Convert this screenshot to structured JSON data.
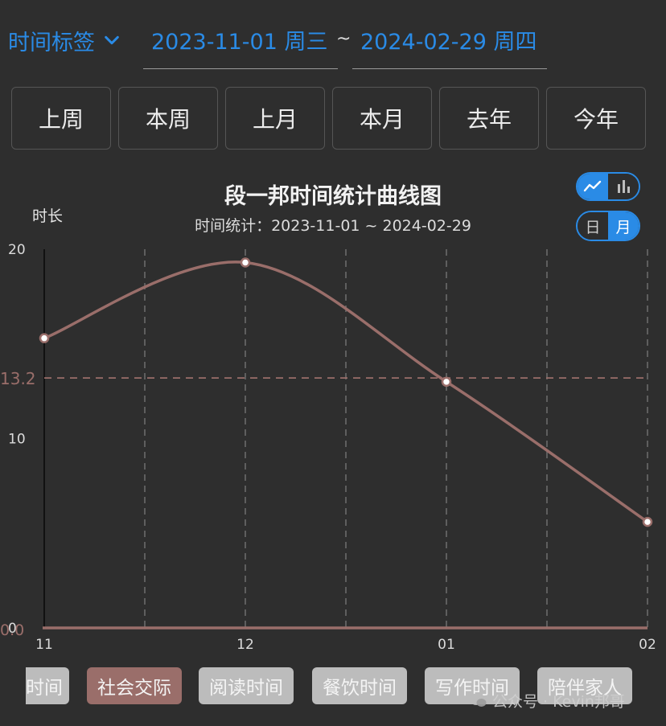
{
  "filter": {
    "tag_label": "时间标签",
    "start_date": "2023-11-01 周三",
    "separator": "~",
    "end_date": "2024-02-29 周四"
  },
  "quick_ranges": [
    "上周",
    "本周",
    "上月",
    "本月",
    "去年",
    "今年"
  ],
  "chart_type_toggle": {
    "line_icon": "line-chart-icon",
    "bar_icon": "bar-chart-icon",
    "active": "line"
  },
  "period_toggle": {
    "day": "日",
    "month": "月",
    "active": "month"
  },
  "legend_items": [
    {
      "label": "时间",
      "active": false
    },
    {
      "label": "社会交际",
      "active": true
    },
    {
      "label": "阅读时间",
      "active": false
    },
    {
      "label": "餐饮时间",
      "active": false
    },
    {
      "label": "写作时间",
      "active": false
    },
    {
      "label": "陪伴家人",
      "active": false
    }
  ],
  "watermark": "公众号 · Kevin邦哥",
  "colors": {
    "accent": "#2a8be6",
    "series": "#9a6e6a",
    "background": "#2e2e2e"
  },
  "chart_data": {
    "type": "line",
    "title": "段一邦时间统计曲线图",
    "subtitle": "时间统计：2023-11-01 ~ 2024-02-29",
    "ylabel": "时长",
    "categories": [
      "11",
      "12",
      "01",
      "02"
    ],
    "series": [
      {
        "name": "社会交际",
        "values": [
          15.3,
          19.3,
          13.0,
          5.6
        ]
      }
    ],
    "ylim": [
      0,
      20
    ],
    "yticks": [
      "20",
      "10",
      "0"
    ],
    "average_line": {
      "value": 13.2,
      "label": "13.2"
    },
    "zero_label": "0.0",
    "grid": "vertical-dashed",
    "curve": "smooth"
  }
}
